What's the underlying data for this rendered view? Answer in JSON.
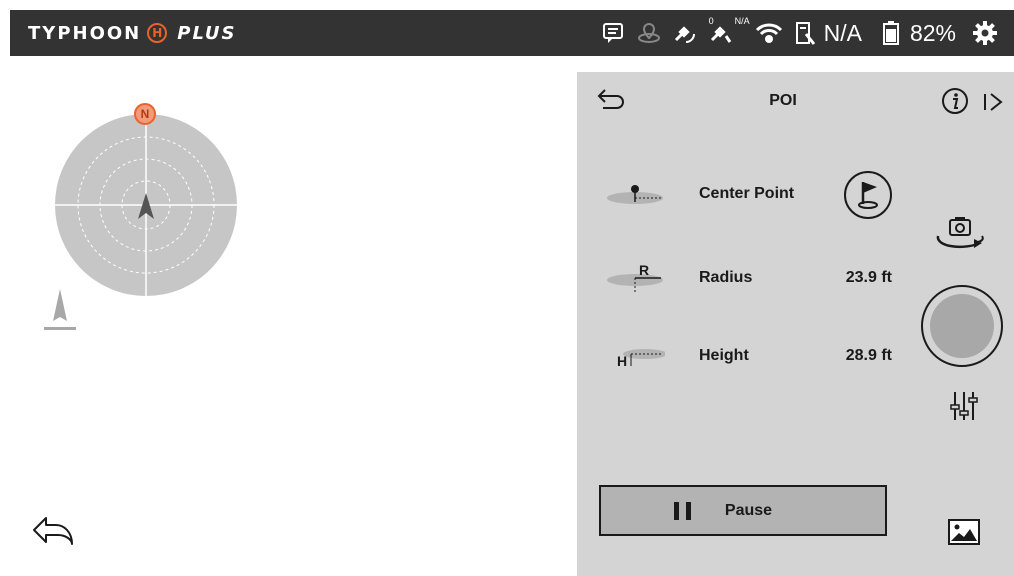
{
  "topbar": {
    "brand_left": "TYPHOON",
    "brand_mark": "H",
    "brand_right": "PLUS",
    "icons": [
      "message-icon",
      "gps-icon",
      "satellite-icon",
      "satellite-na-icon",
      "wifi-icon",
      "rc-battery-icon",
      "drone-battery-icon",
      "gear-icon"
    ],
    "sat_count": "0",
    "sat_na": "N/A",
    "rc_battery": "N/A",
    "drone_battery": "82%"
  },
  "compass": {
    "north_label": "N"
  },
  "poi_panel": {
    "title": "POI",
    "rows": [
      {
        "label": "Center Point",
        "value": "",
        "icon": "center-point-icon"
      },
      {
        "label": "Radius",
        "value": "23.9 ft",
        "icon": "radius-icon",
        "icon_letter": "R"
      },
      {
        "label": "Height",
        "value": "28.9 ft",
        "icon": "height-icon",
        "icon_letter": "H"
      }
    ],
    "pause_label": "Pause"
  },
  "colors": {
    "topbar": "#333333",
    "panel": "#d4d4d4",
    "accent": "#e8632b",
    "button": "#b3b3b3"
  }
}
